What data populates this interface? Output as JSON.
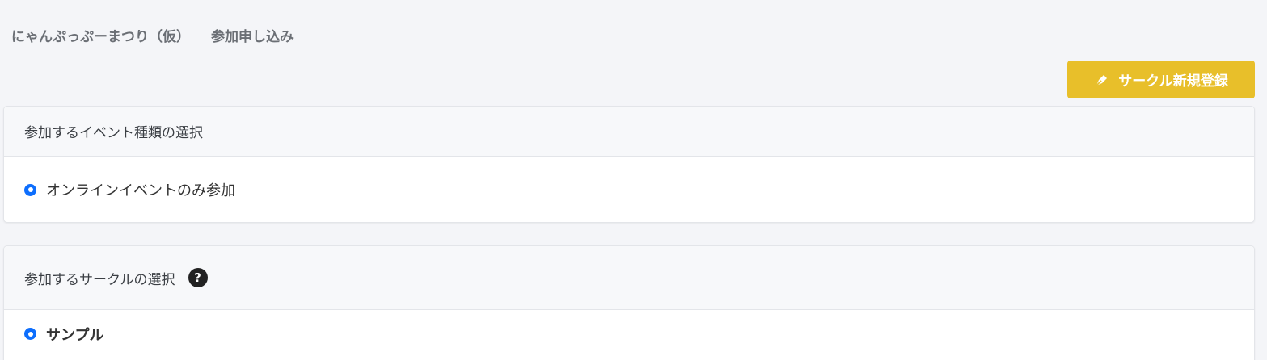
{
  "header": {
    "event_name": "にゃんぷっぷーまつり（仮）",
    "page_title": "参加申し込み"
  },
  "new_circle_button": {
    "label": "サークル新規登録",
    "icon": "pen-icon",
    "color": "#e8bf2a"
  },
  "event_type_section": {
    "title": "参加するイベント種類の選択",
    "options": [
      {
        "label": "オンラインイベントのみ参加",
        "selected": true
      }
    ]
  },
  "circle_section": {
    "title": "参加するサークルの選択",
    "help_icon": "?",
    "options": [
      {
        "label": "サンプル",
        "selected": true
      }
    ]
  },
  "accent_color": "#0d6efd"
}
